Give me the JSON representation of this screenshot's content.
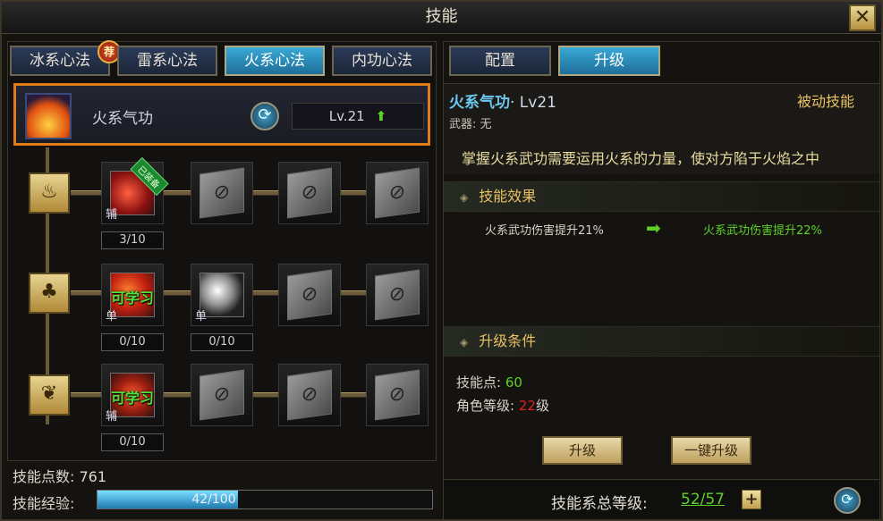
{
  "window": {
    "title": "技能",
    "close_label": "✕"
  },
  "tabs": [
    {
      "label": "冰系心法",
      "badge": "荐"
    },
    {
      "label": "雷系心法"
    },
    {
      "label": "火系心法",
      "active": true
    },
    {
      "label": "内功心法"
    }
  ],
  "selected_skill": {
    "name": "火系气功",
    "level": "Lv.21",
    "icon": "fire-icon"
  },
  "tree": {
    "rows": [
      {
        "element_icon": "fire-element-icon",
        "slots": [
          {
            "state": "equipped",
            "corner": "辅",
            "tag": "已装备",
            "progress": "3/10"
          },
          {
            "state": "locked"
          },
          {
            "state": "locked"
          },
          {
            "state": "locked"
          }
        ]
      },
      {
        "element_icon": "flame-element-icon",
        "slots": [
          {
            "state": "learnable",
            "corner": "单",
            "learn_label": "可学习",
            "progress": "0/10"
          },
          {
            "state": "available",
            "corner": "单",
            "progress": "0/10"
          },
          {
            "state": "locked"
          },
          {
            "state": "locked"
          }
        ]
      },
      {
        "element_icon": "leaf-element-icon",
        "slots": [
          {
            "state": "learnable",
            "corner": "辅",
            "learn_label": "可学习",
            "progress": "0/10"
          },
          {
            "state": "locked"
          },
          {
            "state": "locked"
          },
          {
            "state": "locked"
          }
        ]
      }
    ]
  },
  "stats": {
    "points_label": "技能点数:",
    "points_value": "761",
    "exp_label": "技能经验:",
    "exp_text": "42/100",
    "exp_fraction": 0.42
  },
  "right": {
    "tabs": [
      {
        "label": "配置"
      },
      {
        "label": "升级",
        "active": true
      }
    ],
    "skill_title": "火系气功",
    "skill_level": "· Lv21",
    "skill_type": "被动技能",
    "weapon": "武器: 无",
    "description": "掌握火系武功需要运用火系的力量，使对方陷于火焰之中",
    "effect_header": "技能效果",
    "effect_current": "火系武功伤害提升21%",
    "effect_next": "火系武功伤害提升22%",
    "cond_header": "升级条件",
    "cond_points_label": "技能点:",
    "cond_points_value": "60",
    "cond_level_label": "角色等级:",
    "cond_level_value": "22",
    "cond_level_unit": "级",
    "upgrade_btn": "升级",
    "upgrade_all_btn": "一键升级",
    "total_label": "技能系总等级:",
    "total_value": "52/57"
  },
  "colors": {
    "accent_orange": "#e07b1c",
    "tab_active": "#39a9d4",
    "green": "#4fe03a",
    "red": "#e02020",
    "gold": "#e8c066"
  }
}
